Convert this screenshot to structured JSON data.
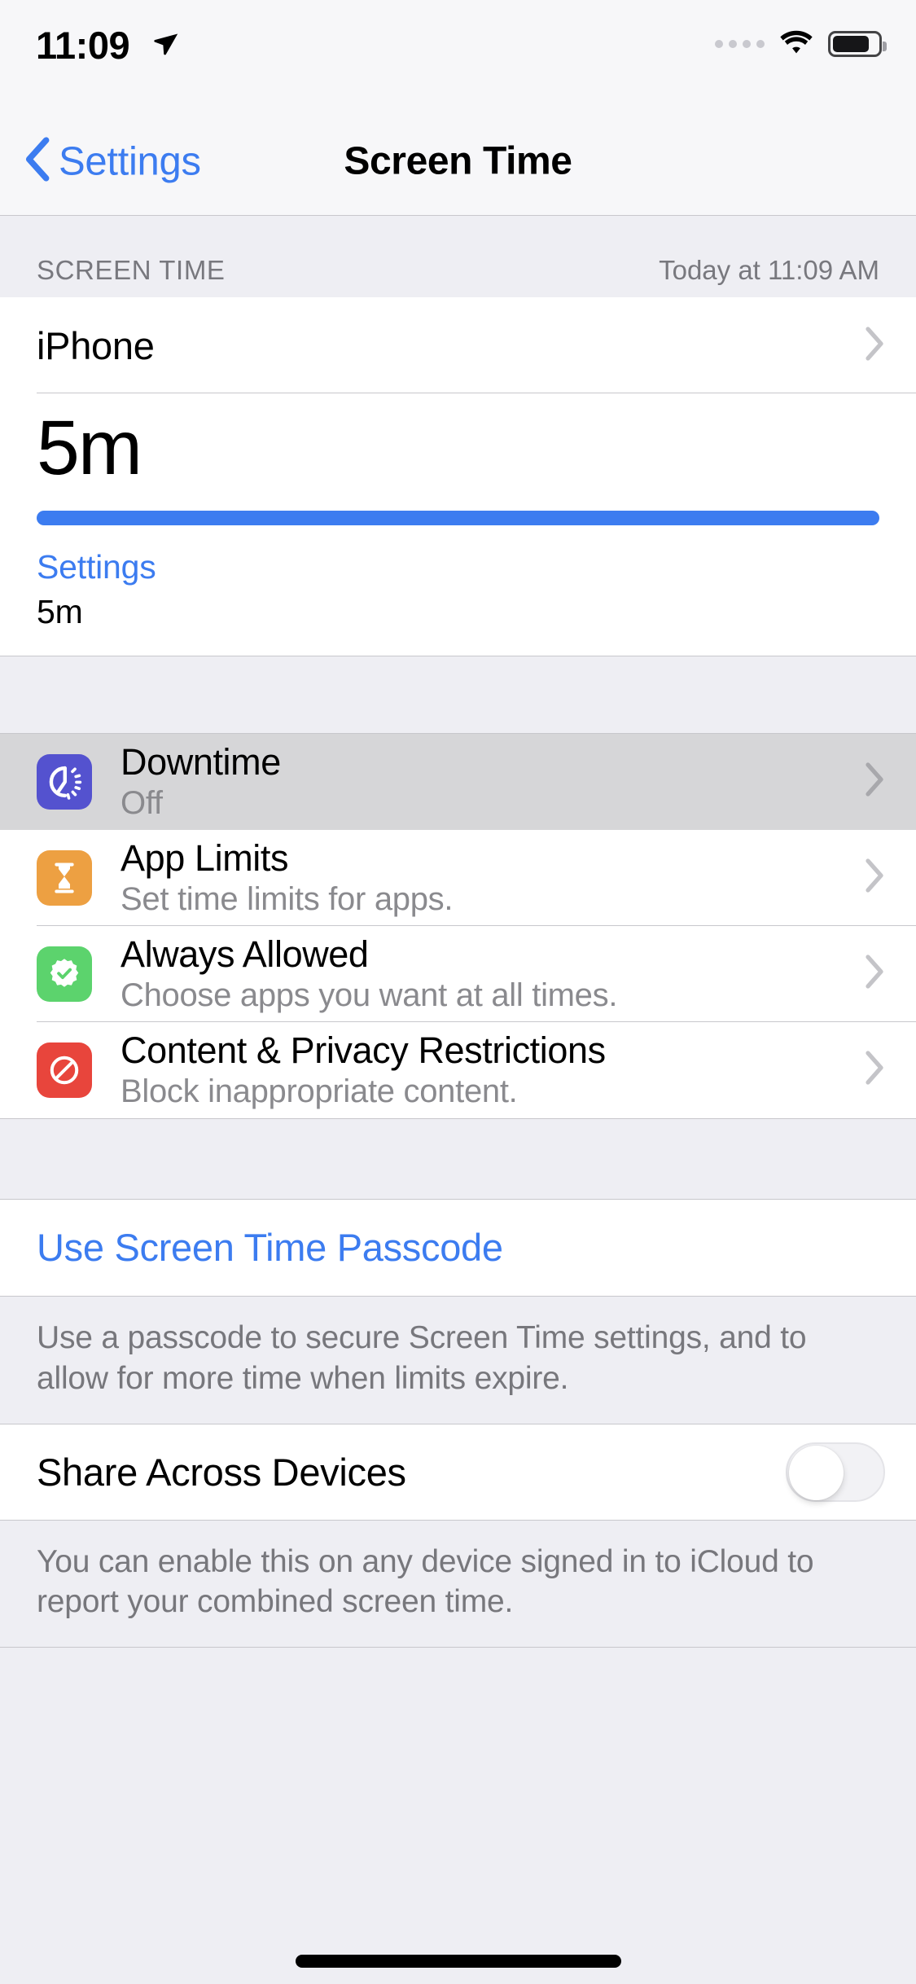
{
  "status_bar": {
    "time": "11:09",
    "location_icon": "location-arrow-icon",
    "signal_icon": "signal-dots-icon",
    "wifi_icon": "wifi-icon",
    "battery_icon": "battery-icon"
  },
  "nav": {
    "back_label": "Settings",
    "back_icon": "chevron-left-icon",
    "title": "Screen Time"
  },
  "screen_time_section": {
    "header_left": "SCREEN TIME",
    "header_right": "Today at 11:09 AM",
    "device_row": {
      "label": "iPhone",
      "chevron": "chevron-right-icon"
    },
    "usage": {
      "total": "5m",
      "bar_color": "#3c7cf0",
      "bar_percent": 100,
      "category": "Settings",
      "category_color": "#3c7cf0",
      "duration": "5m"
    }
  },
  "features": [
    {
      "title": "Downtime",
      "subtitle": "Off",
      "icon": "downtime-icon",
      "icon_color": "#5452cf",
      "pressed": true,
      "chevron": "chevron-right-icon"
    },
    {
      "title": "App Limits",
      "subtitle": "Set time limits for apps.",
      "icon": "hourglass-icon",
      "icon_color": "#eda042",
      "pressed": false,
      "chevron": "chevron-right-icon"
    },
    {
      "title": "Always Allowed",
      "subtitle": "Choose apps you want at all times.",
      "icon": "checkmark-seal-icon",
      "icon_color": "#5cd36d",
      "pressed": false,
      "chevron": "chevron-right-icon"
    },
    {
      "title": "Content & Privacy Restrictions",
      "subtitle": "Block inappropriate content.",
      "icon": "no-entry-icon",
      "icon_color": "#e8453c",
      "pressed": false,
      "chevron": "chevron-right-icon"
    }
  ],
  "passcode_section": {
    "link_label": "Use Screen Time Passcode",
    "footer": "Use a passcode to secure Screen Time settings, and to allow for more time when limits expire."
  },
  "share_section": {
    "label": "Share Across Devices",
    "toggle_on": false,
    "footer": "You can enable this on any device signed in to iCloud to report your combined screen time."
  }
}
